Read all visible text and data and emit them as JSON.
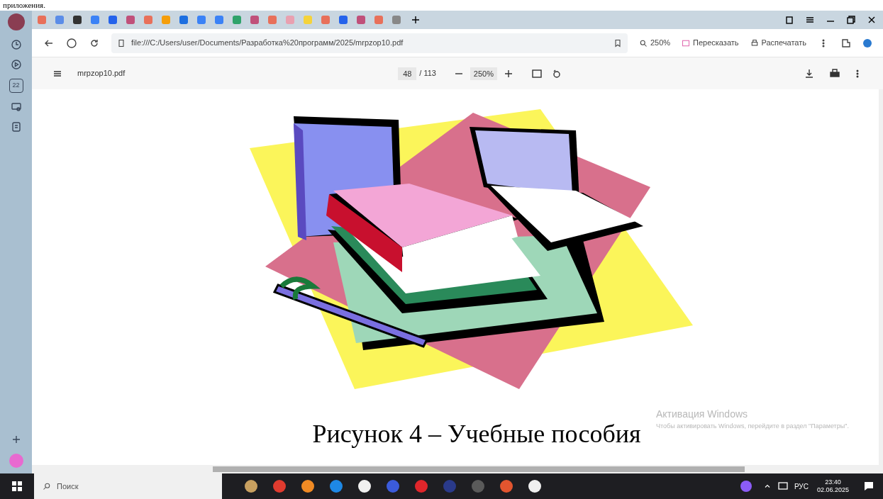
{
  "document_top_text": "приложения.",
  "sidebar": {
    "calendar_day": "22"
  },
  "address_bar": {
    "url": "file:///C:/Users/user/Documents/Разработка%20программ/2025/mrpzop10.pdf",
    "zoom": "250%",
    "buttons": [
      "Пересказать",
      "Распечатать"
    ]
  },
  "pdf_toolbar": {
    "file_name": "mrpzop10.pdf",
    "page": "48",
    "page_total": "/ 113",
    "zoom": "250%"
  },
  "page": {
    "caption": "Рисунок 4 – Учебные пособия"
  },
  "activation_notice": {
    "title": "Активация Windows",
    "text": "Чтобы активировать Windows, перейдите в раздел \"Параметры\"."
  },
  "taskbar": {
    "search_placeholder": "Поиск",
    "language": "РУС",
    "time": "23:40",
    "date": "02.06.2025"
  }
}
